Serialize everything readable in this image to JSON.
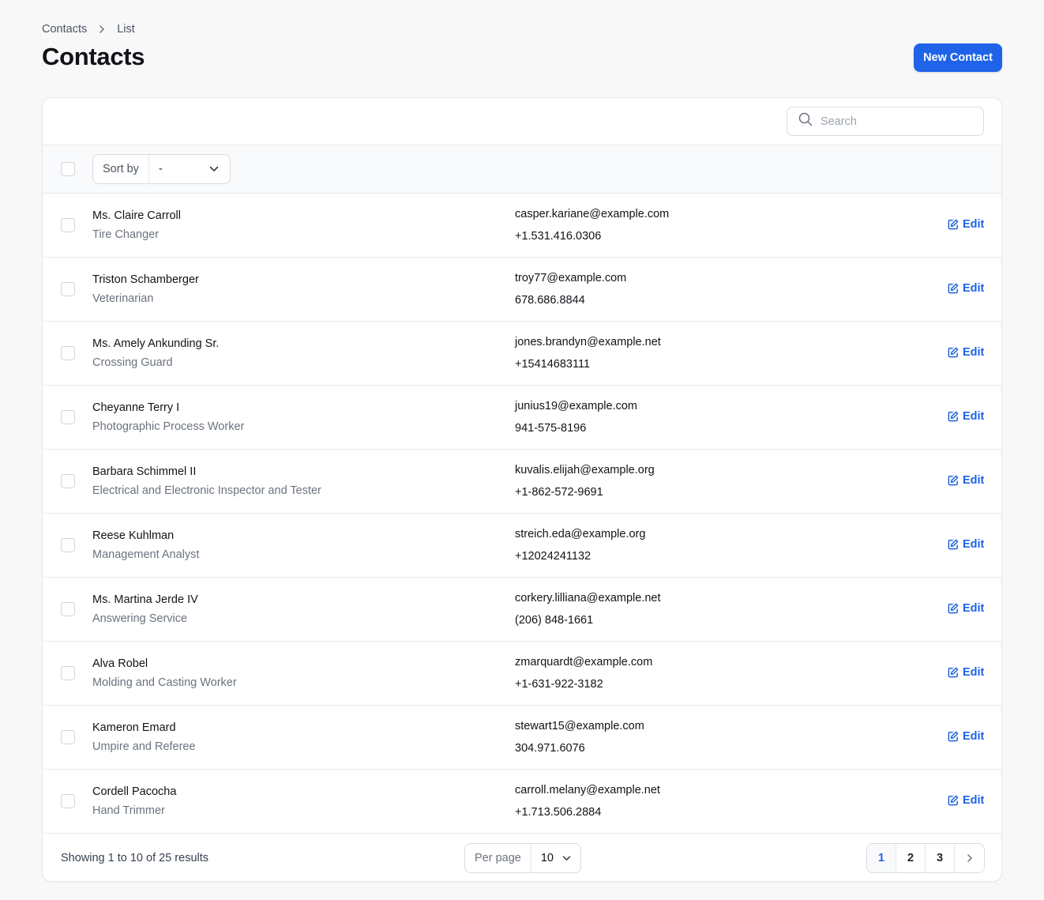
{
  "breadcrumb": {
    "root": "Contacts",
    "current": "List"
  },
  "title": "Contacts",
  "new_button": "New Contact",
  "search": {
    "placeholder": "Search"
  },
  "sort": {
    "label": "Sort by",
    "value": "-"
  },
  "rows": [
    {
      "name": "Ms. Claire Carroll",
      "job": "Tire Changer",
      "email": "casper.kariane@example.com",
      "phone": "+1.531.416.0306",
      "edit": "Edit"
    },
    {
      "name": "Triston Schamberger",
      "job": "Veterinarian",
      "email": "troy77@example.com",
      "phone": "678.686.8844",
      "edit": "Edit"
    },
    {
      "name": "Ms. Amely Ankunding Sr.",
      "job": "Crossing Guard",
      "email": "jones.brandyn@example.net",
      "phone": "+15414683111",
      "edit": "Edit"
    },
    {
      "name": "Cheyanne Terry I",
      "job": "Photographic Process Worker",
      "email": "junius19@example.com",
      "phone": "941-575-8196",
      "edit": "Edit"
    },
    {
      "name": "Barbara Schimmel II",
      "job": "Electrical and Electronic Inspector and Tester",
      "email": "kuvalis.elijah@example.org",
      "phone": "+1-862-572-9691",
      "edit": "Edit"
    },
    {
      "name": "Reese Kuhlman",
      "job": "Management Analyst",
      "email": "streich.eda@example.org",
      "phone": "+12024241132",
      "edit": "Edit"
    },
    {
      "name": "Ms. Martina Jerde IV",
      "job": "Answering Service",
      "email": "corkery.lilliana@example.net",
      "phone": "(206) 848-1661",
      "edit": "Edit"
    },
    {
      "name": "Alva Robel",
      "job": "Molding and Casting Worker",
      "email": "zmarquardt@example.com",
      "phone": "+1-631-922-3182",
      "edit": "Edit"
    },
    {
      "name": "Kameron Emard",
      "job": "Umpire and Referee",
      "email": "stewart15@example.com",
      "phone": "304.971.6076",
      "edit": "Edit"
    },
    {
      "name": "Cordell Pacocha",
      "job": "Hand Trimmer",
      "email": "carroll.melany@example.net",
      "phone": "+1.713.506.2884",
      "edit": "Edit"
    }
  ],
  "footer": {
    "showing": "Showing 1 to 10 of 25 results",
    "per_page_label": "Per page",
    "per_page_value": "10",
    "pages": [
      "1",
      "2",
      "3"
    ],
    "current_page": "1"
  },
  "colors": {
    "accent": "#1f63e8"
  },
  "icons": {
    "search": "search-icon",
    "edit": "edit-icon",
    "chevron": "chevron-down-icon",
    "next": "chevron-right-icon"
  }
}
